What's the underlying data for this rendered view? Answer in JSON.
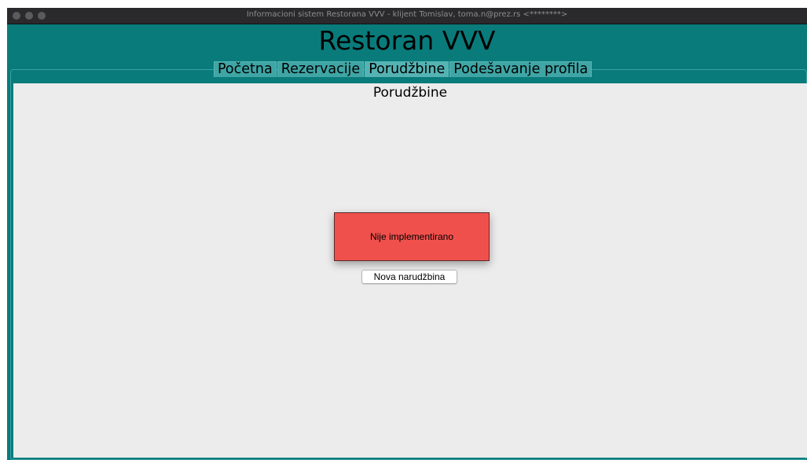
{
  "window": {
    "title": "Informacioni sistem Restorana VVV - klijent Tomislav, toma.n@prez.rs <********>"
  },
  "app": {
    "title": "Restoran VVV"
  },
  "tabs": [
    {
      "label": "Početna"
    },
    {
      "label": "Rezervacije"
    },
    {
      "label": "Porudžbine",
      "active": true
    },
    {
      "label": "Podešavanje profila"
    }
  ],
  "main": {
    "page_title": "Porudžbine",
    "alert_text": "Nije implementirano",
    "new_order_button": "Nova narudžbina"
  },
  "colors": {
    "window_background": "#0a7b7b",
    "content_background": "#ececec",
    "alert_background": "#f0504c"
  }
}
